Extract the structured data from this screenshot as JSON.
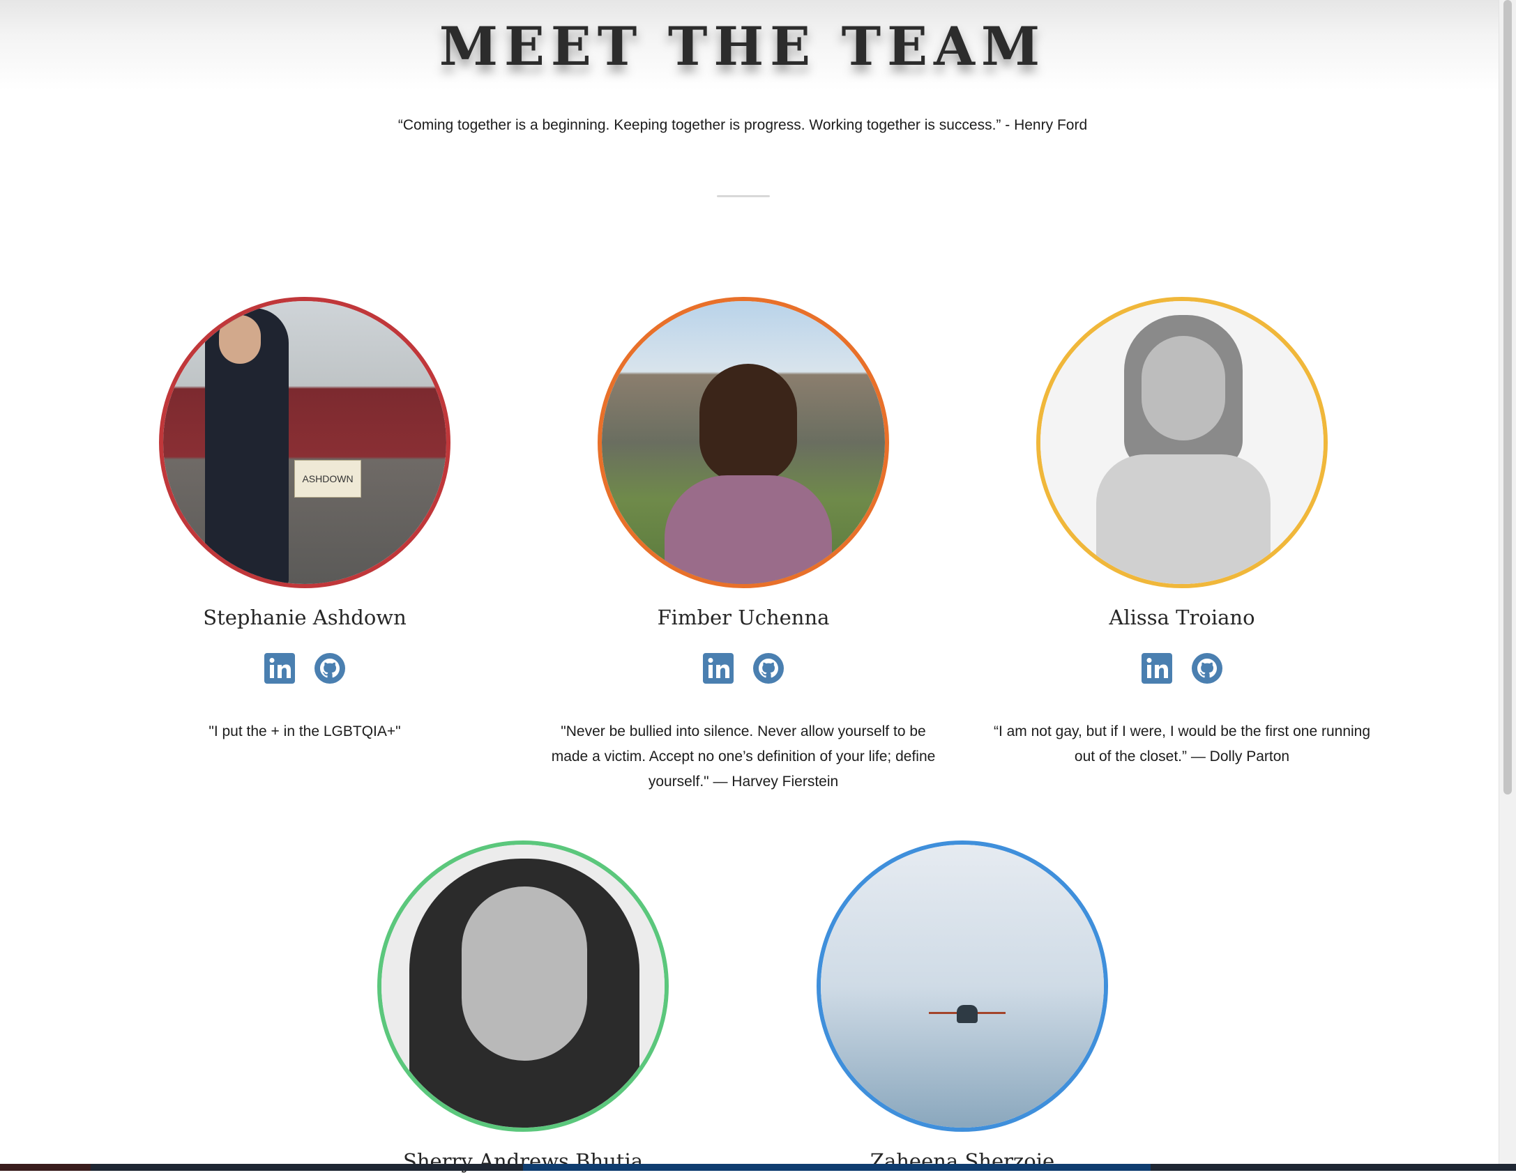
{
  "page": {
    "title": "MEET THE TEAM",
    "quote": "“Coming together is a beginning. Keeping together is progress. Working together is success.” - Henry Ford"
  },
  "members": [
    {
      "name": "Stephanie Ashdown",
      "bio": "\"I put the + in the LGBTQIA+\"",
      "ring_color": "#c0373a",
      "photo_sign": "ASHDOWN"
    },
    {
      "name": "Fimber Uchenna",
      "bio": "\"Never be bullied into silence. Never allow yourself to be made a victim. Accept no one’s definition of your life; define yourself.\" — Harvey Fierstein",
      "ring_color": "#e8702a"
    },
    {
      "name": "Alissa Troiano",
      "bio": "“I am not gay, but if I were, I would be the first one running out of the closet.” — Dolly Parton",
      "ring_color": "#f0b73a"
    },
    {
      "name": "Sherry Andrews Bhutia",
      "ring_color": "#5bc77c"
    },
    {
      "name": "Zaheena Sherzoie",
      "ring_color": "#3f8fdb"
    }
  ],
  "icons": {
    "linkedin": "linkedin-icon",
    "github": "github-icon",
    "icon_color": "#4a7fb0"
  }
}
